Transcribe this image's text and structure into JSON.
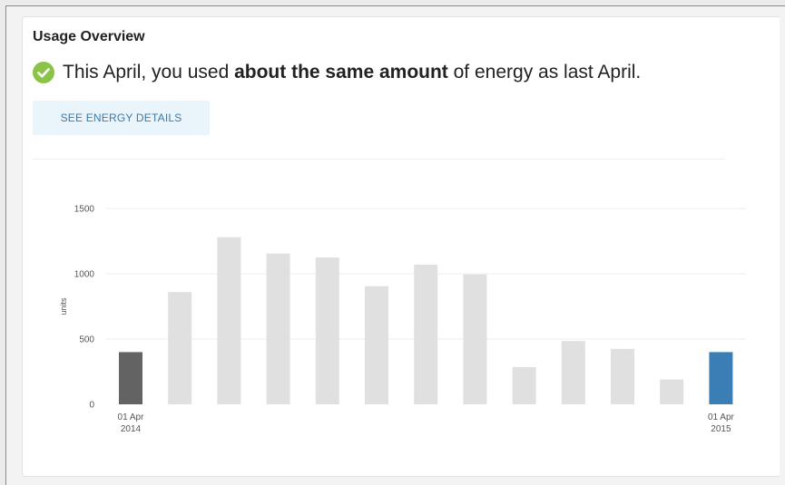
{
  "card": {
    "title": "Usage Overview",
    "summary_prefix": "This April, you used ",
    "summary_bold": "about the same amount",
    "summary_suffix": " of energy as last April.",
    "details_button": "SEE ENERGY DETAILS",
    "status_icon": "check-circle-icon",
    "status_color": "#8bc34a"
  },
  "chart_data": {
    "type": "bar",
    "ylabel": "units",
    "ylim": [
      0,
      1500
    ],
    "yticks": [
      0,
      500,
      1000,
      1500
    ],
    "values": [
      400,
      860,
      1280,
      1155,
      1125,
      905,
      1070,
      995,
      285,
      485,
      425,
      190,
      400
    ],
    "x_labels": [
      {
        "index": 0,
        "line1": "01 Apr",
        "line2": "2014"
      },
      {
        "index": 12,
        "line1": "01 Apr",
        "line2": "2015"
      }
    ],
    "colors": {
      "first": "#636363",
      "last": "#3a7eb5",
      "default": "#e0e0e0",
      "grid": "#eeeeee"
    }
  }
}
